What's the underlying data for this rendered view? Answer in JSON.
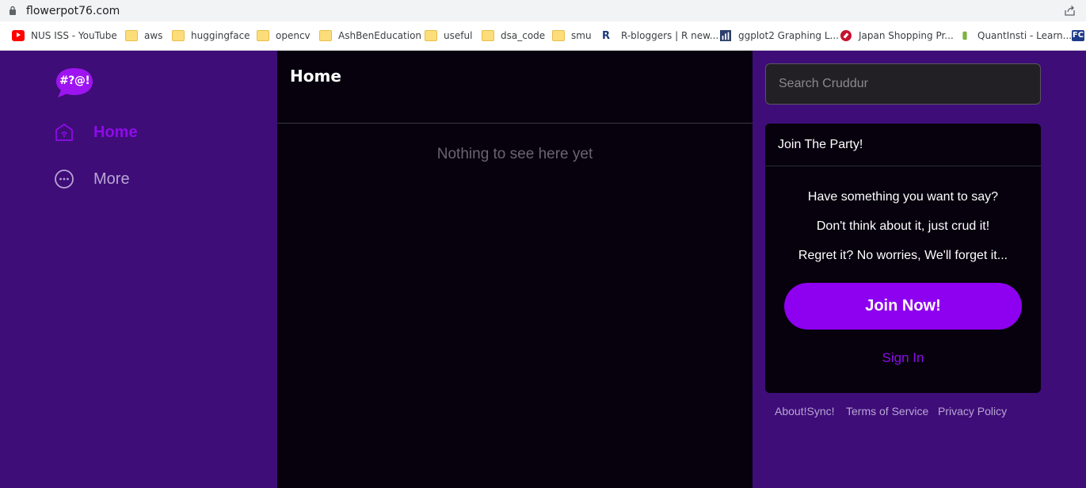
{
  "browser": {
    "url": "flowerpot76.com",
    "bookmarks": [
      {
        "label": "NUS ISS - YouTube",
        "icon": "youtube-icon"
      },
      {
        "label": "aws",
        "icon": "folder-icon"
      },
      {
        "label": "huggingface",
        "icon": "folder-icon"
      },
      {
        "label": "opencv",
        "icon": "folder-icon"
      },
      {
        "label": "AshBenEducation",
        "icon": "folder-icon"
      },
      {
        "label": "useful",
        "icon": "folder-icon"
      },
      {
        "label": "dsa_code",
        "icon": "folder-icon"
      },
      {
        "label": "smu",
        "icon": "folder-icon"
      },
      {
        "label": "R-bloggers | R new...",
        "icon": "r-bloggers-icon"
      },
      {
        "label": "ggplot2 Graphing L...",
        "icon": "ggplot-icon"
      },
      {
        "label": "Japan Shopping Pr...",
        "icon": "japan-shopping-icon"
      },
      {
        "label": "QuantInsti - Learn...",
        "icon": "quantinsti-icon"
      }
    ]
  },
  "sidebar": {
    "logo_text": "#?@!",
    "items": [
      {
        "label": "Home",
        "icon": "home-icon",
        "active": true
      },
      {
        "label": "More",
        "icon": "more-icon",
        "active": false
      }
    ]
  },
  "main": {
    "title": "Home",
    "empty_message": "Nothing to see here yet"
  },
  "right": {
    "search_placeholder": "Search Cruddur",
    "card": {
      "title": "Join The Party!",
      "line1": "Have something you want to say?",
      "line2": "Don't think about it, just crud it!",
      "line3": "Regret it? No worries, We'll forget it...",
      "join_label": "Join Now!",
      "signin_label": "Sign In"
    },
    "footer": {
      "about": "About!Sync!",
      "terms": "Terms of Service",
      "privacy": "Privacy Policy"
    }
  },
  "colors": {
    "background": "#3e0d78",
    "panel": "#06010d",
    "accent": "#8e00f0",
    "muted": "#b9a6d4"
  }
}
